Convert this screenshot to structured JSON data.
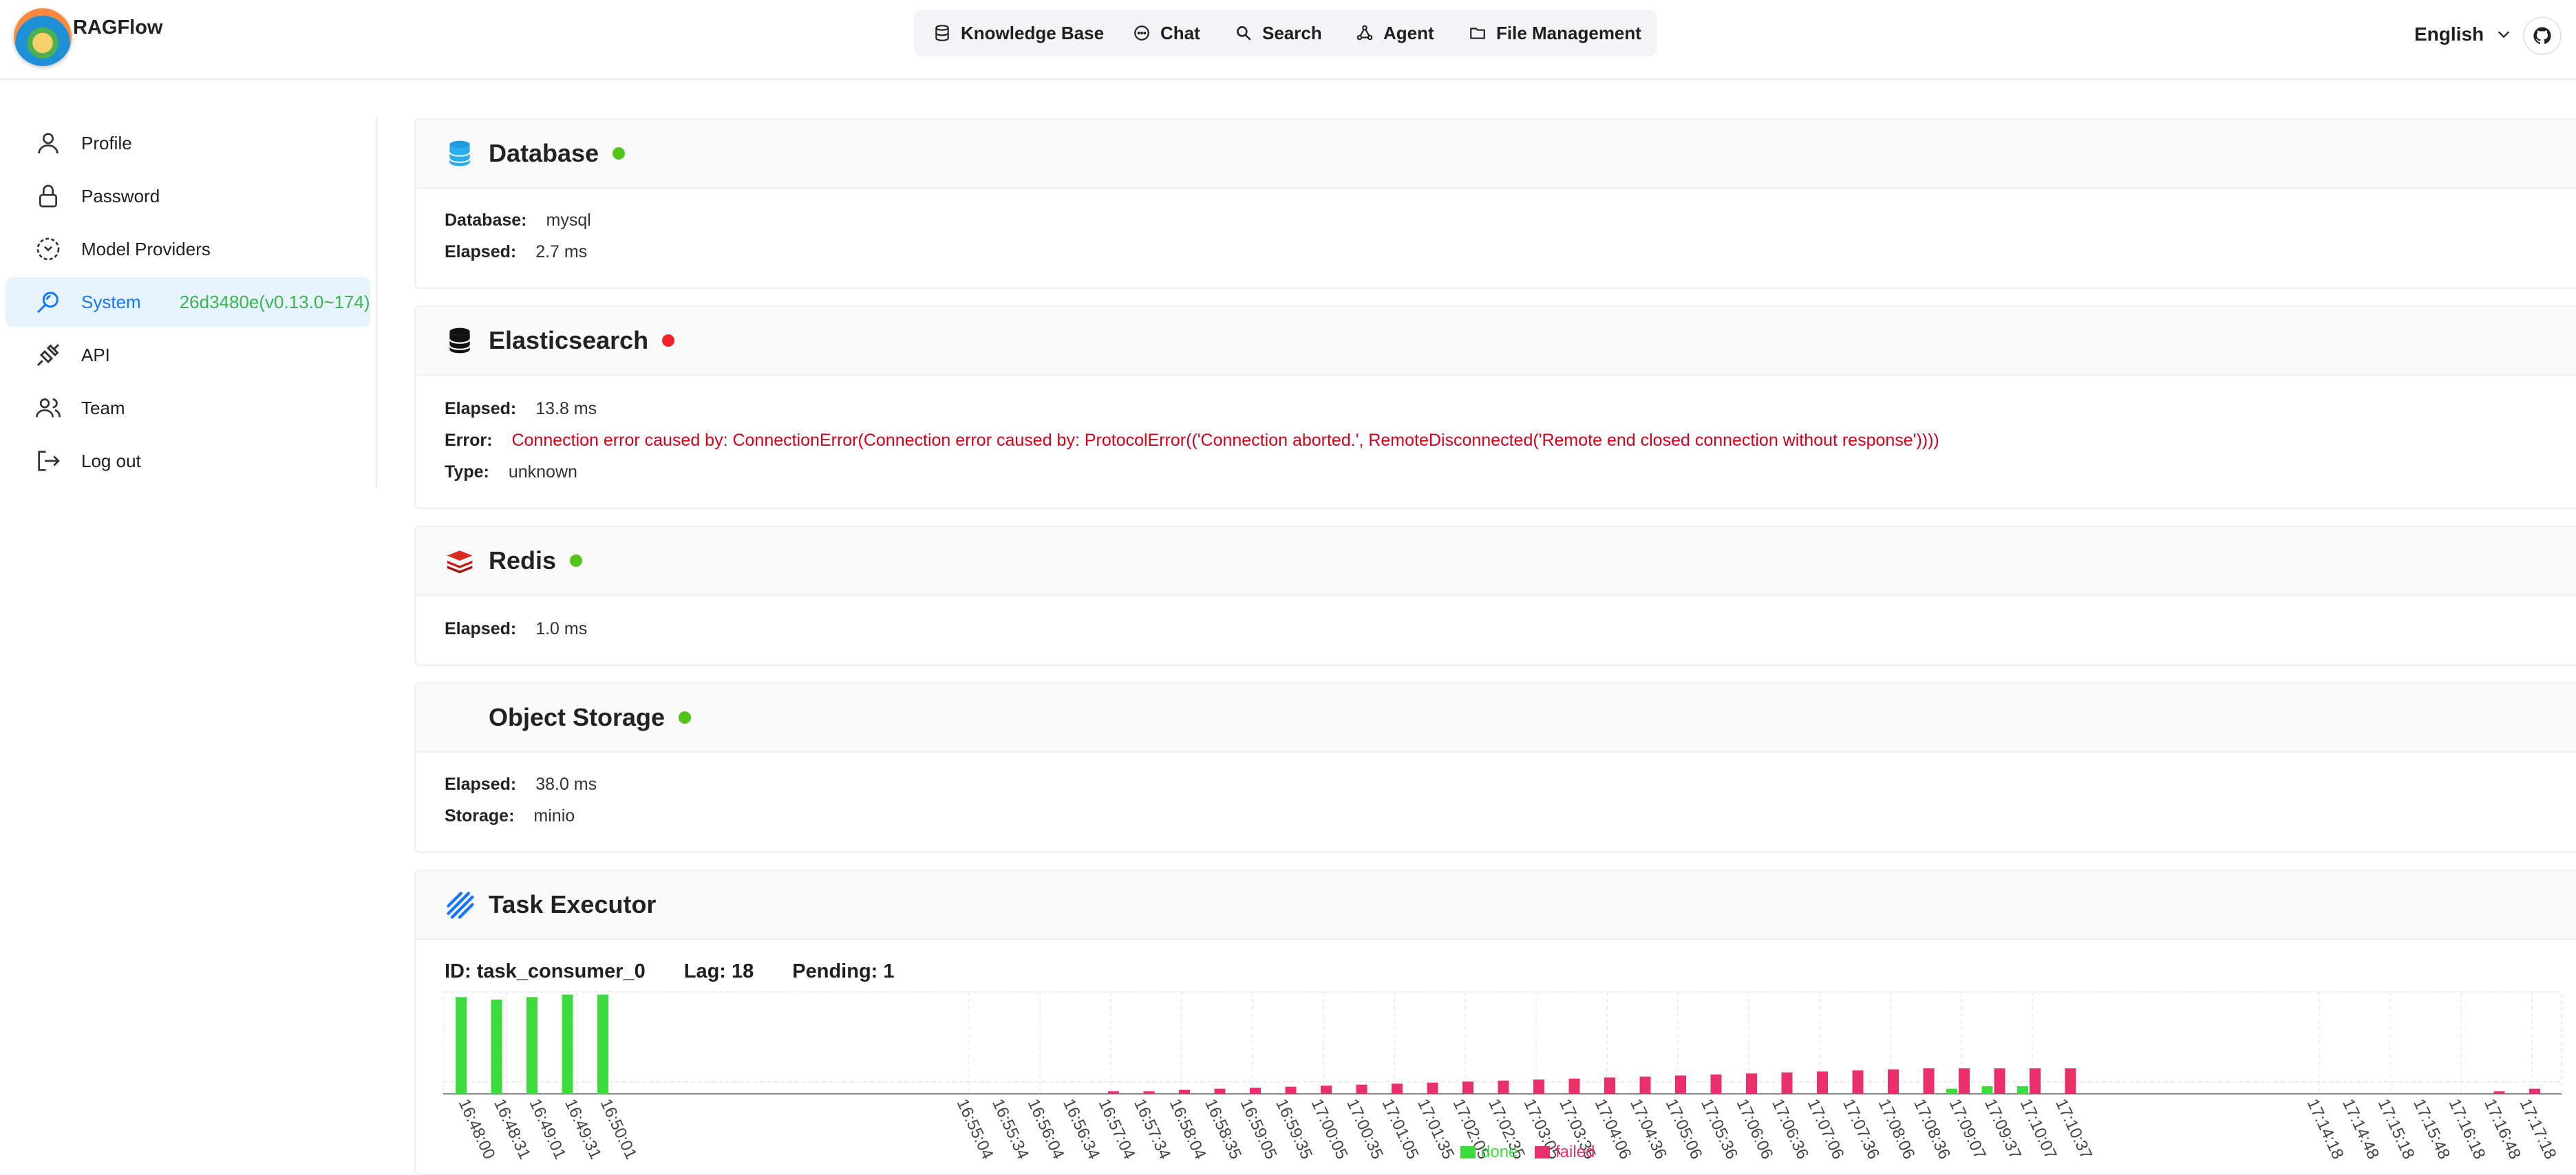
{
  "header": {
    "brand": "RAGFlow",
    "nav": [
      {
        "label": "Knowledge Base",
        "icon": "database-icon"
      },
      {
        "label": "Chat",
        "icon": "chat-icon"
      },
      {
        "label": "Search",
        "icon": "search-icon"
      },
      {
        "label": "Agent",
        "icon": "agent-icon"
      },
      {
        "label": "File Management",
        "icon": "folder-icon"
      }
    ],
    "language": "English"
  },
  "sidebar": {
    "items": [
      {
        "label": "Profile",
        "icon": "user-icon"
      },
      {
        "label": "Password",
        "icon": "lock-icon"
      },
      {
        "label": "Model Providers",
        "icon": "model-icon"
      },
      {
        "label": "System",
        "icon": "system-icon",
        "version": "26d3480e(v0.13.0~174)",
        "active": true
      },
      {
        "label": "API",
        "icon": "api-icon"
      },
      {
        "label": "Team",
        "icon": "team-icon"
      },
      {
        "label": "Log out",
        "icon": "logout-icon"
      }
    ]
  },
  "database": {
    "title": "Database",
    "status": "ok",
    "db_label": "Database:",
    "db_value": "mysql",
    "elapsed_label": "Elapsed:",
    "elapsed_value": "2.7 ms"
  },
  "elasticsearch": {
    "title": "Elasticsearch",
    "status": "error",
    "elapsed_label": "Elapsed:",
    "elapsed_value": "13.8 ms",
    "error_label": "Error:",
    "error_value": "Connection error caused by: ConnectionError(Connection error caused by: ProtocolError(('Connection aborted.', RemoteDisconnected('Remote end closed connection without response'))))",
    "type_label": "Type:",
    "type_value": "unknown"
  },
  "redis": {
    "title": "Redis",
    "status": "ok",
    "elapsed_label": "Elapsed:",
    "elapsed_value": "1.0 ms"
  },
  "storage": {
    "title": "Object Storage",
    "status": "ok",
    "elapsed_label": "Elapsed:",
    "elapsed_value": "38.0 ms",
    "storage_label": "Storage:",
    "storage_value": "minio"
  },
  "task_executor": {
    "title": "Task Executor",
    "id_text": "ID: task_consumer_0",
    "lag_text": "Lag: 18",
    "pending_text": "Pending: 1"
  },
  "colors": {
    "done": "#3ddc3d",
    "failed": "#eb2f6b",
    "accent": "#1677ff"
  },
  "chart_data": {
    "type": "bar",
    "legend": [
      "done",
      "failed"
    ],
    "categories": [
      "16:48:00",
      "16:48:31",
      "16:49:01",
      "16:49:31",
      "16:50:01",
      "16:55:04",
      "16:55:34",
      "16:56:04",
      "16:56:34",
      "16:57:04",
      "16:57:34",
      "16:58:04",
      "16:58:35",
      "16:59:05",
      "16:59:35",
      "17:00:05",
      "17:00:35",
      "17:01:05",
      "17:01:35",
      "17:02:05",
      "17:02:35",
      "17:03:05",
      "17:03:35",
      "17:04:06",
      "17:04:36",
      "17:05:06",
      "17:05:36",
      "17:06:06",
      "17:06:36",
      "17:07:06",
      "17:07:36",
      "17:08:06",
      "17:08:36",
      "17:09:07",
      "17:09:37",
      "17:10:07",
      "17:10:37",
      "17:14:18",
      "17:14:48",
      "17:15:18",
      "17:15:48",
      "17:16:18",
      "17:16:48",
      "17:17:18"
    ],
    "series": [
      {
        "name": "done",
        "values": [
          1.9,
          1.85,
          1.9,
          1.95,
          1.95,
          0,
          0,
          0,
          0,
          0,
          0,
          0,
          0,
          0,
          0,
          0,
          0,
          0,
          0,
          0,
          0,
          0,
          0,
          0,
          0,
          0,
          0,
          0,
          0,
          0,
          0,
          0,
          0,
          0.1,
          0.15,
          0.15,
          0,
          0,
          0,
          0,
          0,
          0,
          0,
          0
        ]
      },
      {
        "name": "failed",
        "values": [
          0,
          0,
          0,
          0,
          0,
          0,
          0,
          0,
          0,
          0.05,
          0.05,
          0.08,
          0.1,
          0.12,
          0.14,
          0.16,
          0.18,
          0.2,
          0.22,
          0.24,
          0.26,
          0.28,
          0.3,
          0.32,
          0.34,
          0.36,
          0.38,
          0.4,
          0.42,
          0.44,
          0.46,
          0.48,
          0.5,
          0.5,
          0.5,
          0.5,
          0.5,
          0,
          0,
          0,
          0,
          0,
          0.05,
          0.1
        ]
      }
    ],
    "ylim": [
      0,
      2
    ]
  }
}
